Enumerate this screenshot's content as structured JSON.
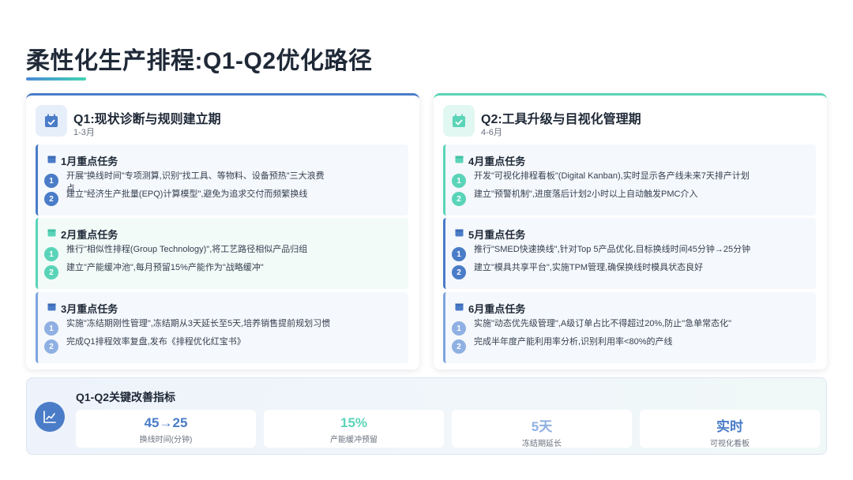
{
  "page": {
    "title": "柔性化生产排程:Q1-Q2优化路径"
  },
  "colors": {
    "blue": "#4a7cc8",
    "teal": "#5ad4b8",
    "light_blue": "#8fb0e2"
  },
  "q1": {
    "icon": "calendar-icon",
    "title": "Q1:现状诊断与规则建立期",
    "subtitle": "1-3月",
    "months": [
      {
        "title": "1月重点任务",
        "tasks": [
          {
            "num": "1",
            "text": "开展\"换线时间\"专项测算,识别\"找工具、等物料、设备预热\"三大浪费点"
          },
          {
            "num": "2",
            "text": "建立\"经济生产批量(EPQ)计算模型\",避免为追求交付而频繁换线"
          }
        ]
      },
      {
        "title": "2月重点任务",
        "tasks": [
          {
            "num": "1",
            "text": "推行\"相似性排程(Group Technology)\",将工艺路径相似产品归组"
          },
          {
            "num": "2",
            "text": "建立\"产能缓冲池\",每月预留15%产能作为\"战略缓冲\""
          }
        ]
      },
      {
        "title": "3月重点任务",
        "tasks": [
          {
            "num": "1",
            "text": "实施\"冻结期刚性管理\",冻结期从3天延长至5天,培养销售提前规划习惯"
          },
          {
            "num": "2",
            "text": "完成Q1排程效率复盘,发布《排程优化红宝书》"
          }
        ]
      }
    ]
  },
  "q2": {
    "icon": "calendar-check-icon",
    "title": "Q2:工具升级与目视化管理期",
    "subtitle": "4-6月",
    "months": [
      {
        "title": "4月重点任务",
        "tasks": [
          {
            "num": "1",
            "text": "开发\"可视化排程看板\"(Digital Kanban),实时显示各产线未来7天排产计划"
          },
          {
            "num": "2",
            "text": "建立\"预警机制\",进度落后计划2小时以上自动触发PMC介入"
          }
        ]
      },
      {
        "title": "5月重点任务",
        "tasks": [
          {
            "num": "1",
            "text": "推行\"SMED快速换线\",针对Top 5产品优化,目标换线时间45分钟→25分钟"
          },
          {
            "num": "2",
            "text": "建立\"模具共享平台\",实施TPM管理,确保换线时模具状态良好"
          }
        ]
      },
      {
        "title": "6月重点任务",
        "tasks": [
          {
            "num": "1",
            "text": "实施\"动态优先级管理\",A级订单占比不得超过20%,防止\"急单常态化\""
          },
          {
            "num": "2",
            "text": "完成半年度产能利用率分析,识别利用率<80%的产线"
          }
        ]
      }
    ]
  },
  "metrics": {
    "icon": "line-chart-icon",
    "title": "Q1-Q2关键改善指标",
    "items": [
      {
        "value": "45→25",
        "label": "换线时间(分钟)",
        "color": "#4a7cc8"
      },
      {
        "value": "15%",
        "label": "产能缓冲预留",
        "color": "#5ad4b8"
      },
      {
        "value": "5天",
        "label": "冻结期延长",
        "color": "#8fb0e2"
      },
      {
        "value": "实时",
        "label": "可视化看板",
        "color": "#4a7cc8"
      }
    ]
  }
}
